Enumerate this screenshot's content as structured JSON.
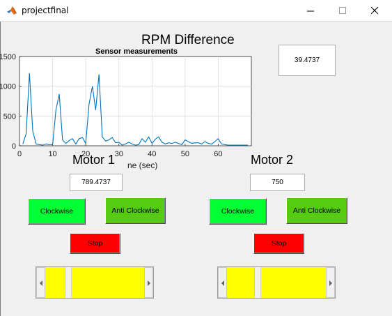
{
  "window": {
    "title": "projectfinal"
  },
  "rpm_difference": {
    "title": "RPM Difference",
    "value": "39.4737"
  },
  "motor1": {
    "title": "Motor 1",
    "value": "789.4737",
    "clockwise_label": "Clockwise",
    "anticlockwise_label": "Anti Clockwise",
    "stop_label": "Stop"
  },
  "motor2": {
    "title": "Motor 2",
    "value": "750",
    "clockwise_label": "Clockwise",
    "anticlockwise_label": "Anti Clockwise",
    "stop_label": "Stop"
  },
  "colors": {
    "clockwise": "#00ff33",
    "anticlockwise": "#55cc11",
    "stop": "#ff0000",
    "slider": "#ffff00",
    "line": "#0072bd"
  },
  "chart_data": {
    "type": "line",
    "title": "Sensor measurements",
    "xlabel": "ne (sec)",
    "ylabel": "",
    "xlim": [
      0,
      70
    ],
    "ylim": [
      0,
      1500
    ],
    "x_ticks": [
      0,
      10,
      20,
      30,
      40,
      50,
      60
    ],
    "y_ticks": [
      0,
      500,
      1000,
      1500
    ],
    "grid": true,
    "series": [
      {
        "x": [
          1,
          2,
          3,
          4,
          5,
          6,
          7,
          8,
          9,
          10,
          11,
          12,
          13,
          14,
          15,
          16,
          17,
          18,
          19,
          20,
          21,
          22,
          23,
          24,
          25,
          26,
          27,
          28,
          29,
          30,
          31,
          32,
          33,
          34,
          35,
          36,
          37,
          38,
          39,
          40,
          41,
          42,
          43,
          44,
          45,
          46,
          47,
          48,
          49,
          50,
          51,
          52,
          53,
          54,
          55,
          56,
          57,
          58,
          59,
          60,
          61,
          62,
          63,
          64,
          65,
          66,
          67,
          68,
          69
        ],
        "values": [
          30,
          200,
          1220,
          250,
          30,
          20,
          10,
          30,
          20,
          20,
          600,
          870,
          100,
          40,
          90,
          120,
          30,
          120,
          140,
          40,
          700,
          1000,
          600,
          1200,
          150,
          80,
          100,
          140,
          50,
          60,
          10,
          30,
          60,
          30,
          10,
          20,
          120,
          60,
          150,
          40,
          110,
          150,
          60,
          30,
          50,
          40,
          60,
          40,
          20,
          100,
          70,
          40,
          50,
          50,
          30,
          70,
          40,
          30,
          70,
          120,
          30,
          20,
          10,
          10,
          10,
          10,
          10,
          10,
          10
        ]
      }
    ]
  }
}
